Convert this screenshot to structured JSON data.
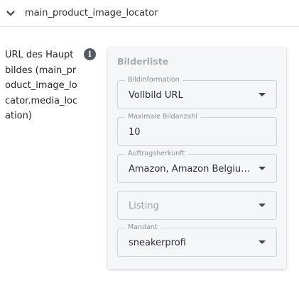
{
  "section": {
    "title": "main_product_image_locator",
    "toggle_icon": "chevron-down-icon"
  },
  "field": {
    "label": "URL des Hauptbildes (main_product_image_locator.media_location)",
    "info_icon": "info-icon",
    "info_glyph": "i"
  },
  "card": {
    "title": "Bilderliste",
    "fields": [
      {
        "legend": "Bildinformation",
        "value": "Vollbild URL",
        "type": "select"
      },
      {
        "legend": "Maximale Bildanzahl",
        "value": "10",
        "type": "input"
      },
      {
        "legend": "Auftragsherkunft",
        "value": "Amazon, Amazon Belgium, Amazon Deutschland",
        "type": "select"
      },
      {
        "legend": "",
        "placeholder": "Listing",
        "value": "",
        "type": "select"
      },
      {
        "legend": "Mandant",
        "value": "sneakerprofi",
        "type": "select"
      }
    ]
  },
  "colors": {
    "card_background": "#f4f6f8",
    "border": "#cdd1d6",
    "info_icon": "#555b63"
  }
}
